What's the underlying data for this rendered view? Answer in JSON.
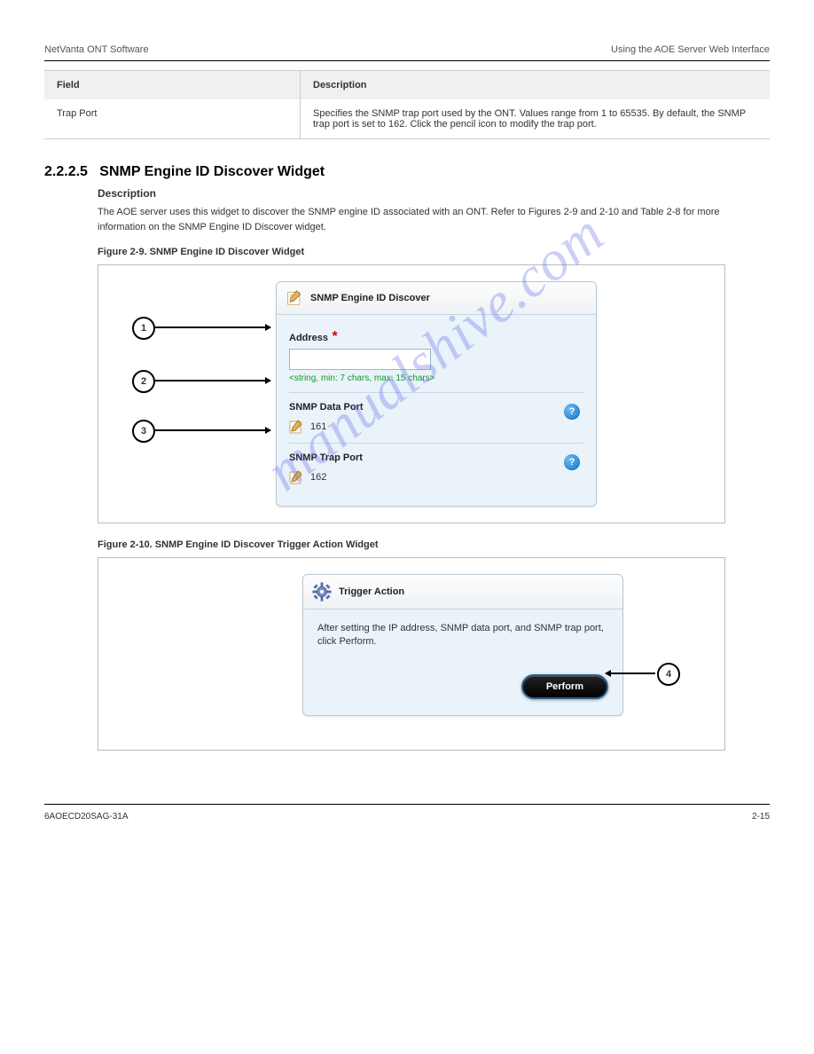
{
  "header": {
    "left": "NetVanta ONT Software",
    "right": "Using the AOE Server Web Interface"
  },
  "table": {
    "th1": "Field",
    "th2": "Description",
    "td1": "Trap Port",
    "td2": "Specifies the SNMP trap port used by the ONT. Values range from 1 to 65535. By default, the SNMP trap port is set to 162. Click the pencil icon to modify the trap port."
  },
  "section": {
    "num": "2.2.2.5",
    "title": "SNMP Engine ID Discover Widget",
    "heading_desc": "Description",
    "body_desc": "The AOE server uses this widget to discover the SNMP engine ID associated with an ONT. Refer to Figures 2-9 and 2-10 and Table 2-8 for more information on the SNMP Engine ID Discover widget.",
    "fig1_caption": "Figure 2-9. SNMP Engine ID Discover Widget",
    "fig2_caption": "Figure 2-10. SNMP Engine ID Discover Trigger Action Widget"
  },
  "panel1": {
    "title": "SNMP Engine ID Discover",
    "address_label": "Address",
    "address_value": "",
    "hint": "<string, min: 7 chars, max: 15 chars>",
    "data_port_label": "SNMP Data Port",
    "data_port_value": "161",
    "trap_port_label": "SNMP Trap Port",
    "trap_port_value": "162"
  },
  "panel2": {
    "title": "Trigger Action",
    "body": "After setting the IP address, SNMP data port, and SNMP trap port, click Perform.",
    "button": "Perform"
  },
  "callouts": {
    "c1": "1",
    "c2": "2",
    "c3": "3",
    "c4": "4"
  },
  "footer": {
    "left": "6AOECD20SAG-31A",
    "right": "2-15"
  },
  "watermark": "manualshive.com"
}
